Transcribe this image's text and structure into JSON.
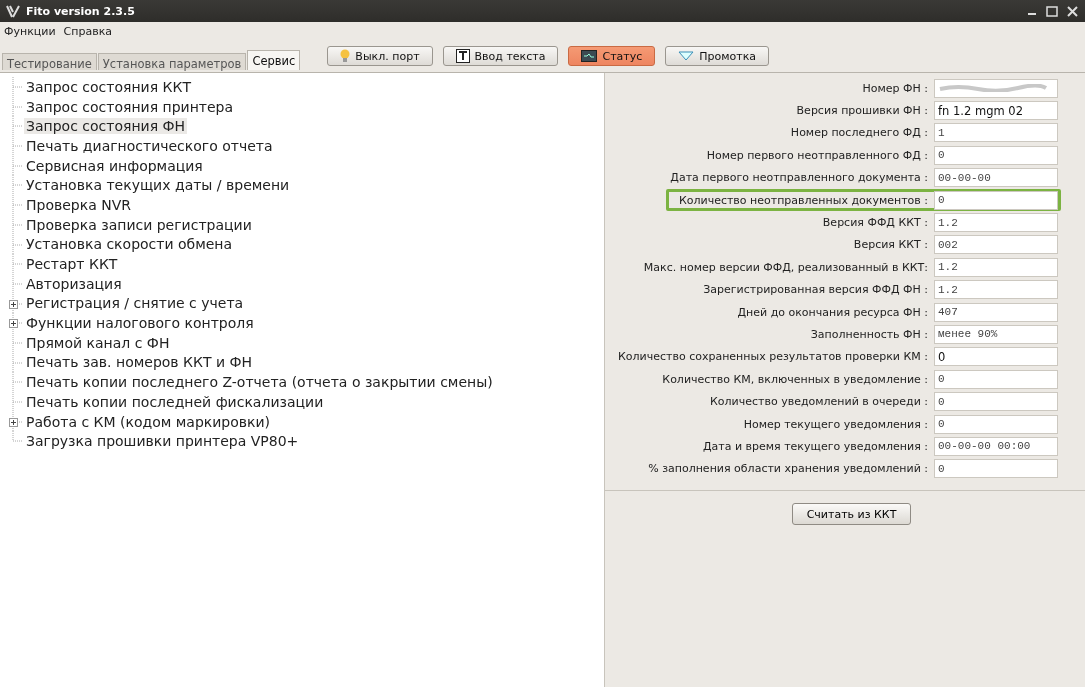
{
  "window": {
    "title": "Fito version 2.3.5"
  },
  "menu": [
    "Функции",
    "Справка"
  ],
  "tabs": [
    {
      "label": "Тестирование",
      "selected": false
    },
    {
      "label": "Установка параметров",
      "selected": false
    },
    {
      "label": "Сервис",
      "selected": true
    }
  ],
  "toolbar": [
    {
      "label": "Выкл. порт",
      "kind": "bulb",
      "selected": false
    },
    {
      "label": "Ввод текста",
      "kind": "text",
      "selected": false
    },
    {
      "label": "Статус",
      "kind": "monitor",
      "selected": true
    },
    {
      "label": "Промотка",
      "kind": "triangle",
      "selected": false
    }
  ],
  "tree": [
    {
      "label": "Запрос состояния ККТ",
      "expandable": false,
      "selected": false
    },
    {
      "label": "Запрос состояния принтера",
      "expandable": false,
      "selected": false
    },
    {
      "label": "Запрос состояния ФН",
      "expandable": false,
      "selected": true
    },
    {
      "label": "Печать диагностического отчета",
      "expandable": false,
      "selected": false
    },
    {
      "label": "Сервисная информация",
      "expandable": false,
      "selected": false
    },
    {
      "label": "Установка текущих даты / времени",
      "expandable": false,
      "selected": false
    },
    {
      "label": "Проверка NVR",
      "expandable": false,
      "selected": false
    },
    {
      "label": "Проверка записи регистрации",
      "expandable": false,
      "selected": false
    },
    {
      "label": "Установка скорости обмена",
      "expandable": false,
      "selected": false
    },
    {
      "label": "Рестарт ККТ",
      "expandable": false,
      "selected": false
    },
    {
      "label": "Авторизация",
      "expandable": false,
      "selected": false
    },
    {
      "label": "Регистрация / снятие с учета",
      "expandable": true,
      "selected": false
    },
    {
      "label": "Функции налогового контроля",
      "expandable": true,
      "selected": false
    },
    {
      "label": "Прямой канал с ФН",
      "expandable": false,
      "selected": false
    },
    {
      "label": "Печать зав. номеров ККТ и ФН",
      "expandable": false,
      "selected": false
    },
    {
      "label": "Печать копии последнего Z-отчета (отчета о закрытии смены)",
      "expandable": false,
      "selected": false
    },
    {
      "label": "Печать копии последней фискализации",
      "expandable": false,
      "selected": false
    },
    {
      "label": "Работа с КМ (кодом маркировки)",
      "expandable": true,
      "selected": false
    },
    {
      "label": "Загрузка прошивки принтера VP80+",
      "expandable": false,
      "selected": false
    }
  ],
  "fields": [
    {
      "label": "Номер ФН :",
      "kind": "blurred",
      "highlighted": false
    },
    {
      "label": "Версия прошивки ФН :",
      "value": "fn 1.2 mgm 02",
      "kind": "sans",
      "highlighted": false
    },
    {
      "label": "Номер последнего ФД :",
      "value": "1",
      "kind": "mono",
      "highlighted": false
    },
    {
      "label": "Номер первого неотправленного ФД :",
      "value": "0",
      "kind": "mono",
      "highlighted": false
    },
    {
      "label": "Дата первого неотправленного документа :",
      "value": "00-00-00",
      "kind": "mono",
      "highlighted": false
    },
    {
      "label": "Количество неотправленных документов :",
      "value": "0",
      "kind": "mono",
      "highlighted": true
    },
    {
      "label": "Версия ФФД ККТ :",
      "value": "1.2",
      "kind": "mono",
      "highlighted": false
    },
    {
      "label": "Версия ККТ :",
      "value": "002",
      "kind": "mono",
      "highlighted": false
    },
    {
      "label": "Макс. номер версии ФФД, реализованный в ККТ:",
      "value": "1.2",
      "kind": "mono",
      "highlighted": false
    },
    {
      "label": "Зарегистрированная версия ФФД ФН :",
      "value": "1.2",
      "kind": "mono",
      "highlighted": false
    },
    {
      "label": "Дней до окончания ресурса ФН :",
      "value": "407",
      "kind": "mono",
      "highlighted": false
    },
    {
      "label": "Заполненность ФН :",
      "value": "менее 90%",
      "kind": "mono",
      "highlighted": false
    },
    {
      "label": "Количество сохраненных результатов проверки КМ :",
      "value": "0",
      "kind": "sans",
      "highlighted": false
    },
    {
      "label": "Количество КМ, включенных в уведомление :",
      "value": "0",
      "kind": "mono",
      "highlighted": false
    },
    {
      "label": "Количество уведомлений в очереди :",
      "value": "0",
      "kind": "mono",
      "highlighted": false
    },
    {
      "label": "Номер текущего уведомления :",
      "value": "0",
      "kind": "mono",
      "highlighted": false
    },
    {
      "label": "Дата и время текущего уведомления :",
      "value": "00-00-00 00:00",
      "kind": "mono",
      "highlighted": false
    },
    {
      "label": "% заполнения области хранения уведомлений :",
      "value": "0",
      "kind": "mono",
      "highlighted": false
    }
  ],
  "read_button": "Считать из ККТ"
}
